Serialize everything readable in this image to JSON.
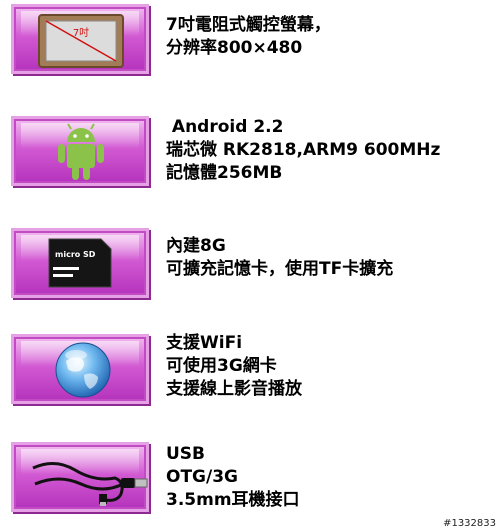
{
  "features": [
    {
      "icon": "tablet-screen-icon",
      "lines": [
        "7吋電阻式觸控螢幕，",
        "分辨率800×480"
      ],
      "badge": "7吋"
    },
    {
      "icon": "android-robot-icon",
      "lines": [
        " Android 2.2",
        "瑞芯微 RK2818,ARM9 600MHz",
        "記憶體256MB"
      ]
    },
    {
      "icon": "microsd-card-icon",
      "lines": [
        "內建8G",
        "可擴充記憶卡，使用TF卡擴充"
      ],
      "card_label": "micro SD"
    },
    {
      "icon": "globe-network-icon",
      "lines": [
        "支援WiFi",
        "可使用3G網卡",
        "支援線上影音播放"
      ]
    },
    {
      "icon": "usb-cable-icon",
      "lines": [
        "USB",
        "OTG/3G",
        "3.5mm耳機接口"
      ]
    }
  ],
  "footer": {
    "id": "#1332833"
  },
  "colors": {
    "tile_top": "#f6c4f2",
    "tile_bottom": "#b22fba"
  }
}
